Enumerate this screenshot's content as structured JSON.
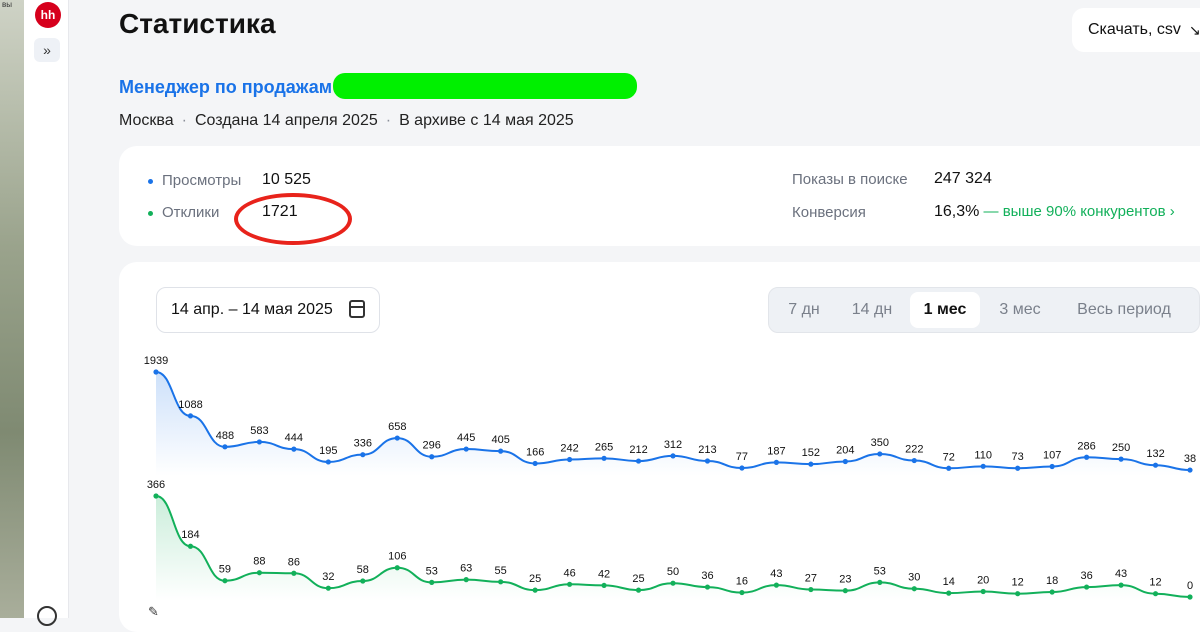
{
  "app": {
    "logo": "hh",
    "expand_icon": "chevrons-right-icon",
    "topleft_text": "вы"
  },
  "page": {
    "title": "Статистика",
    "download_label": "Скачать, csv",
    "download_icon": "download-icon"
  },
  "vacancy": {
    "title": "Менеджер по продажам",
    "city": "Москва",
    "created": "Создана 14 апреля 2025",
    "archived": "В архиве с 14 мая 2025"
  },
  "summary": {
    "views_label": "Просмотры",
    "views_value": "10 525",
    "responses_label": "Отклики",
    "responses_value": "1721",
    "impressions_label": "Показы в поиске",
    "impressions_value": "247 324",
    "conversion_label": "Конверсия",
    "conversion_value": "16,3%",
    "conversion_note": "— выше 90% конкурентов",
    "conversion_arrow": "›"
  },
  "date_range": "14 апр. – 14 мая 2025",
  "periods": [
    "7 дн",
    "14 дн",
    "1 мес",
    "3 мес",
    "Весь период"
  ],
  "active_period": "1 мес",
  "colors": {
    "views": "#1a73e8",
    "responses": "#12b05a",
    "annotation": "#e8231b"
  },
  "chart_data": {
    "type": "line",
    "series": [
      {
        "values": [
          1939,
          1088,
          488,
          583,
          444,
          195,
          336,
          658,
          296,
          445,
          405,
          166,
          242,
          265,
          212,
          312,
          213,
          77,
          187,
          152,
          204,
          350,
          222,
          72,
          110,
          73,
          107,
          286,
          250,
          132,
          38
        ]
      },
      {
        "values": [
          366,
          184,
          59,
          88,
          86,
          32,
          58,
          106,
          53,
          63,
          55,
          25,
          46,
          42,
          25,
          50,
          36,
          16,
          43,
          27,
          23,
          53,
          30,
          14,
          20,
          12,
          18,
          36,
          43,
          12,
          0
        ]
      }
    ]
  }
}
